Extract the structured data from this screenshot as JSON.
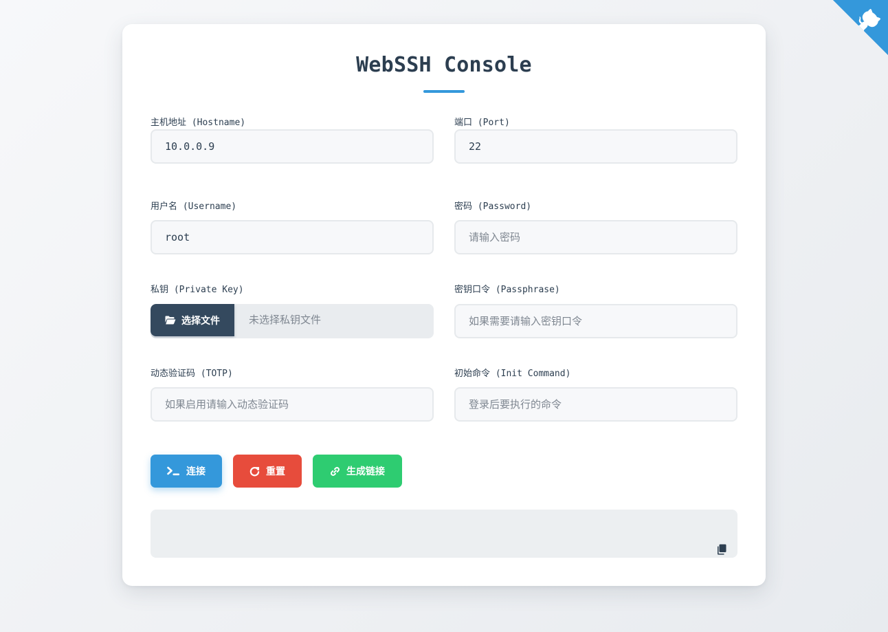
{
  "page": {
    "title": "WebSSH Console"
  },
  "form": {
    "hostname": {
      "label": "主机地址 (Hostname)",
      "value": "10.0.0.9",
      "placeholder": ""
    },
    "port": {
      "label": "端口 (Port)",
      "value": "22",
      "placeholder": ""
    },
    "username": {
      "label": "用户名 (Username)",
      "value": "root",
      "placeholder": ""
    },
    "password": {
      "label": "密码 (Password)",
      "value": "",
      "placeholder": "请输入密码"
    },
    "private_key": {
      "label": "私钥 (Private Key)",
      "button_label": "选择文件",
      "file_status": "未选择私钥文件"
    },
    "passphrase": {
      "label": "密钥口令 (Passphrase)",
      "value": "",
      "placeholder": "如果需要请输入密钥口令"
    },
    "totp": {
      "label": "动态验证码 (TOTP)",
      "value": "",
      "placeholder": "如果启用请输入动态验证码"
    },
    "init_command": {
      "label": "初始命令 (Init Command)",
      "value": "",
      "placeholder": "登录后要执行的命令"
    }
  },
  "actions": {
    "connect_label": "连接",
    "reset_label": "重置",
    "generate_link_label": "生成链接"
  },
  "link_output": {
    "value": ""
  },
  "icons": {
    "corner": "github-icon",
    "file": "folder-open-icon",
    "connect": "terminal-icon",
    "reset": "redo-icon",
    "link": "link-icon",
    "copy": "copy-icon"
  },
  "colors": {
    "accent": "#3498db",
    "danger": "#e74c3c",
    "success": "#2ecc71",
    "dark": "#34495e",
    "text": "#2c3e50"
  }
}
